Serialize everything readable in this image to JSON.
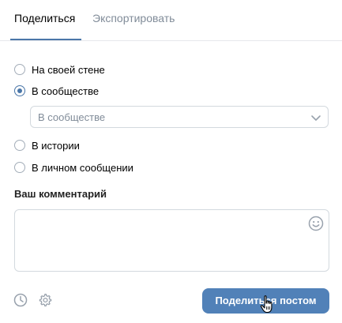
{
  "tabs": [
    {
      "label": "Поделиться",
      "active": true
    },
    {
      "label": "Экспортировать",
      "active": false
    }
  ],
  "share_targets": [
    {
      "label": "На своей стене",
      "checked": false
    },
    {
      "label": "В сообществе",
      "checked": true
    },
    {
      "label": "В истории",
      "checked": false
    },
    {
      "label": "В личном сообщении",
      "checked": false
    }
  ],
  "community_select": {
    "value": "В сообществе",
    "icon": "chevron-down-icon"
  },
  "comment": {
    "label": "Ваш комментарий",
    "value": "",
    "icon": "emoji-icon"
  },
  "footer": {
    "timer_icon": "clock-icon",
    "settings_icon": "gear-icon",
    "submit_label": "Поделиться постом"
  },
  "colors": {
    "accent": "#4a76a8",
    "button": "#5181b8",
    "muted_text": "#818c99",
    "border": "#d3d9de"
  }
}
